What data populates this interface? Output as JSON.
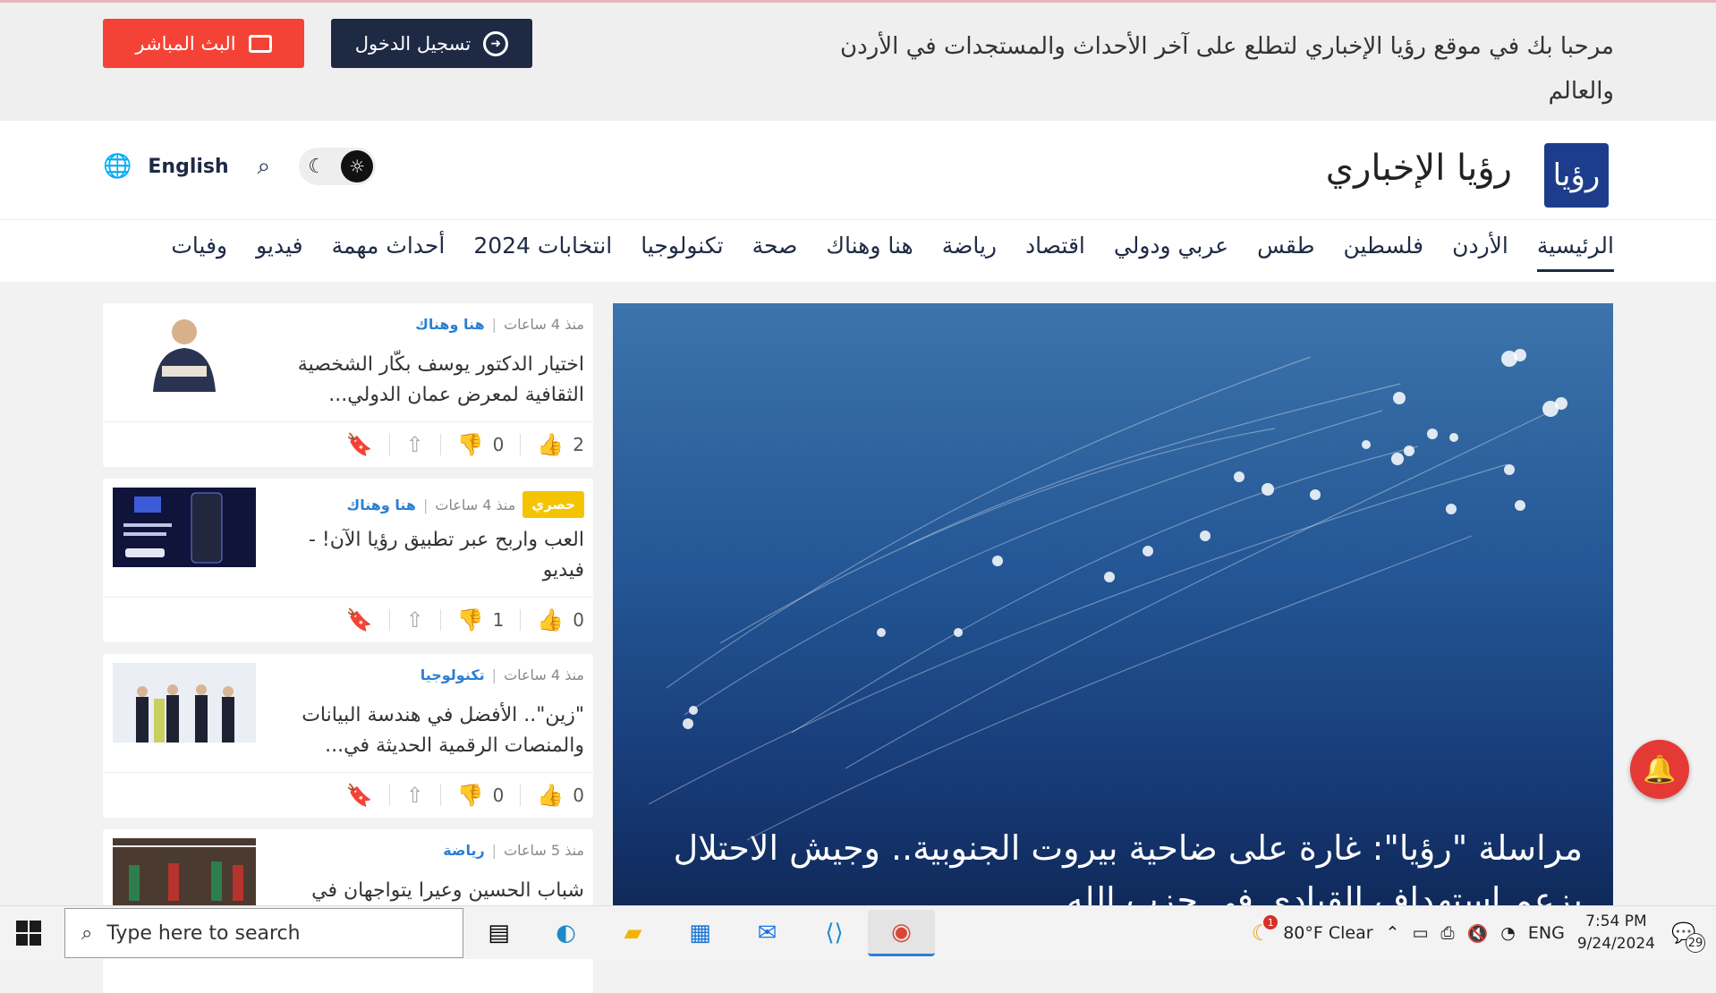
{
  "topbar": {
    "welcome": "مرحبا بك في موقع رؤيا الإخباري لتطلع على آخر الأحداث والمستجدات في الأردن والعالم",
    "login_label": "تسجيل الدخول",
    "live_label": "البث المباشر"
  },
  "header": {
    "brand": "رؤيا الإخباري",
    "logo_text": "رؤيا",
    "lang_label": "English"
  },
  "nav": {
    "items": [
      "الرئيسية",
      "الأردن",
      "فلسطين",
      "طقس",
      "عربي ودولي",
      "اقتصاد",
      "رياضة",
      "هنا وهناك",
      "صحة",
      "تكنولوجيا",
      "انتخابات 2024",
      "أحداث مهمة",
      "فيديو",
      "وفيات"
    ]
  },
  "hero": {
    "title": "مراسلة \"رؤيا\": غارة على ضاحية بيروت الجنوبية.. وجيش الاحتلال يزعم استهداف القيادي في حزب الله"
  },
  "cards": [
    {
      "time": "منذ 4 ساعات",
      "category": "هنا وهناك",
      "title": "اختيار الدكتور يوسف بكّار الشخصية الثقافية لمعرض عمان الدولي...",
      "likes": "2",
      "dislikes": "0"
    },
    {
      "badge": "حصري",
      "time": "منذ 4 ساعات",
      "category": "هنا وهناك",
      "title": "العب واربح عبر تطبيق رؤيا الآن! - فيديو",
      "likes": "0",
      "dislikes": "1"
    },
    {
      "time": "منذ 4 ساعات",
      "category": "تكنولوجيا",
      "title": "\"زين\".. الأفضل في هندسة البيانات والمنصات الرقمية الحديثة في...",
      "likes": "0",
      "dislikes": "0"
    },
    {
      "time": "منذ 5 ساعات",
      "category": "رياضة",
      "title": "شباب الحسين وعيرا يتواجهان في",
      "likes": "",
      "dislikes": ""
    }
  ],
  "taskbar": {
    "search_placeholder": "Type here to search",
    "weather": "80°F  Clear",
    "lang": "ENG",
    "time": "7:54 PM",
    "date": "9/24/2024",
    "notifications": "29",
    "weather_badge": "1"
  }
}
